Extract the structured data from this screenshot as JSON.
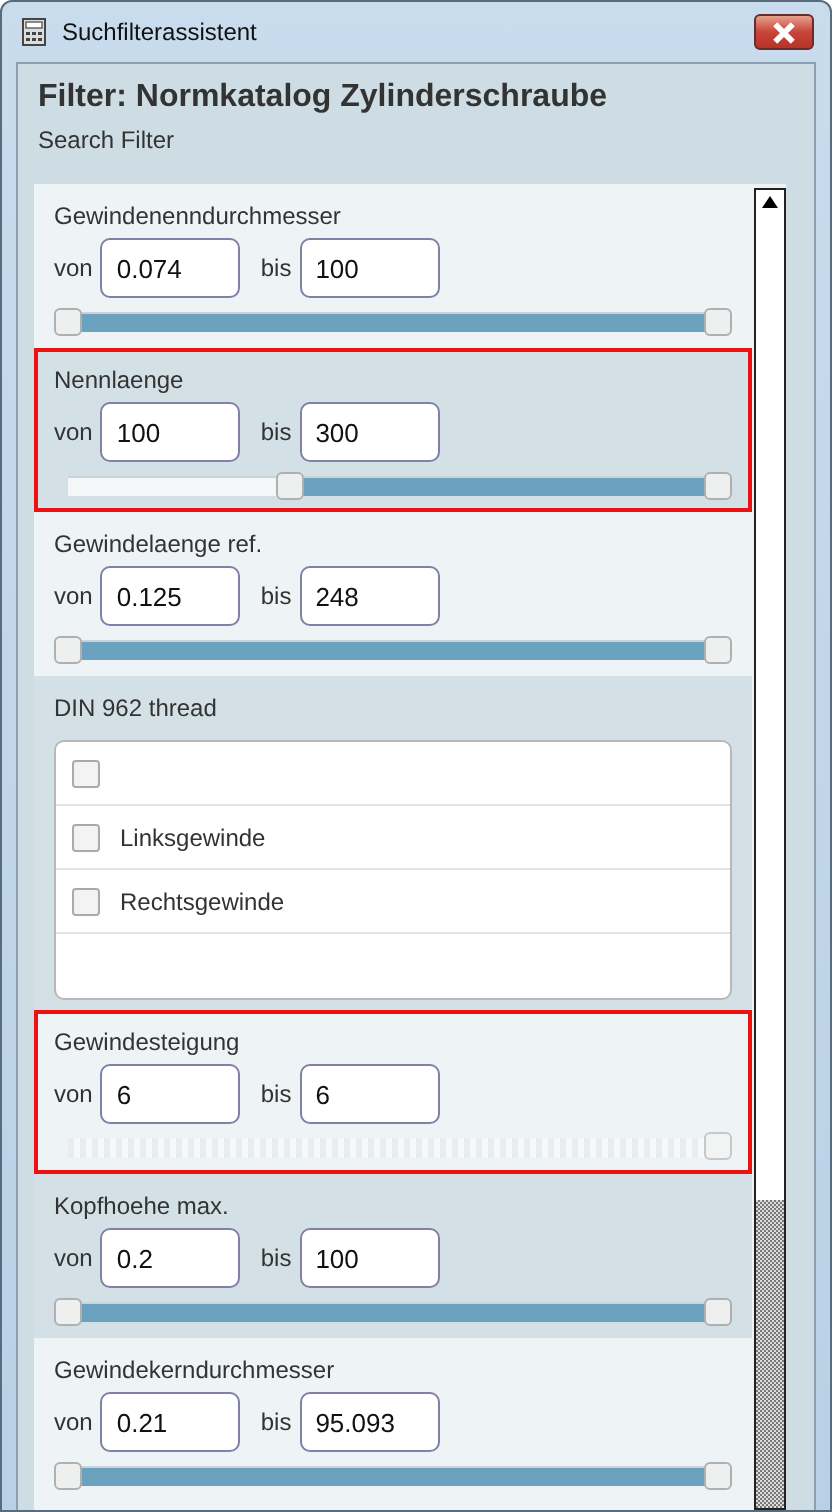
{
  "window": {
    "title": "Suchfilterassistent"
  },
  "header": {
    "title": "Filter: Normkatalog Zylinderschraube",
    "subtitle": "Search Filter"
  },
  "filters": [
    {
      "kind": "range",
      "label": "Gewindenenndurchmesser",
      "highlighted": false,
      "from_label": "von",
      "from": "0.074",
      "to_label": "bis",
      "to": "100",
      "disabled": false,
      "level": 1
    },
    {
      "kind": "range",
      "label": "Nennlaenge",
      "highlighted": true,
      "from_label": "von",
      "from": "100",
      "to_label": "bis",
      "to": "300",
      "disabled": false,
      "level": 0.66
    },
    {
      "kind": "range",
      "label": "Gewindelaenge ref.",
      "highlighted": false,
      "from_label": "von",
      "from": "0.125",
      "to_label": "bis",
      "to": "248",
      "disabled": false,
      "level": 1
    },
    {
      "kind": "checklist",
      "label": "DIN 962 thread",
      "highlighted": false,
      "options": [
        {
          "checked": false
        },
        {
          "label": "Linksgewinde",
          "checked": false
        },
        {
          "label": "Rechtsgewinde",
          "checked": false
        }
      ]
    },
    {
      "kind": "range",
      "label": "Gewindesteigung",
      "highlighted": true,
      "from_label": "von",
      "from": "6",
      "to_label": "bis",
      "to": "6",
      "disabled": true
    },
    {
      "kind": "range",
      "label": "Kopfhoehe max.",
      "highlighted": false,
      "from_label": "von",
      "from": "0.2",
      "to_label": "bis",
      "to": "100",
      "disabled": false,
      "level": 1
    },
    {
      "kind": "range",
      "label": "Gewindekerndurchmesser",
      "highlighted": false,
      "from_label": "von",
      "from": "0.21",
      "to_label": "bis",
      "to": "95.093",
      "disabled": false,
      "level": 1
    }
  ]
}
